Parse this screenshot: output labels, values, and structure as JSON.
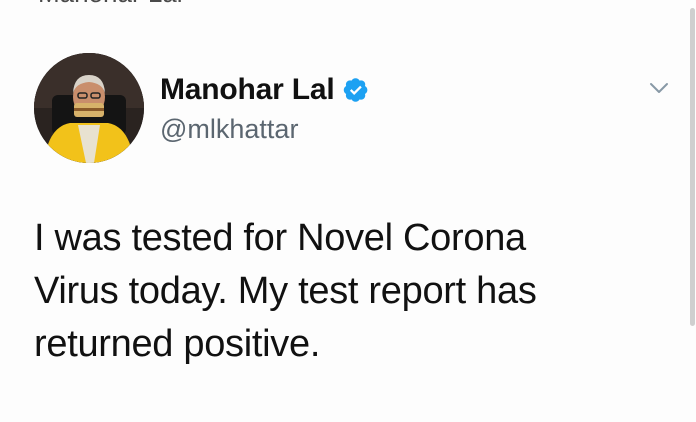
{
  "header": {
    "cut_off_name": "Manohar Lal"
  },
  "tweet": {
    "author": {
      "display_name": "Manohar Lal",
      "handle": "@mlkhattar",
      "verified_icon": "verified-badge-icon",
      "avatar_icon": "profile-avatar"
    },
    "menu_icon": "chevron-down-icon",
    "body_lines": [
      "I was tested for Novel Corona",
      "Virus today. My test report has",
      "returned positive."
    ]
  },
  "colors": {
    "verified_blue": "#1DA1F2",
    "text_primary": "#111111",
    "text_secondary": "#5b6670"
  }
}
